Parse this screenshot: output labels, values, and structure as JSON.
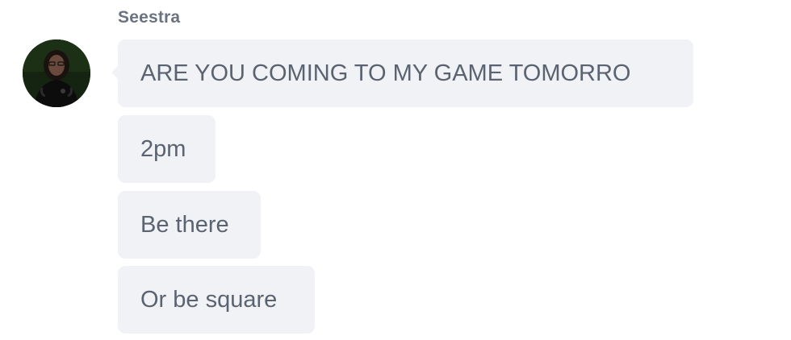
{
  "message_group": {
    "sender": "Seestra",
    "messages": [
      {
        "text": "ARE YOU COMING TO MY GAME TOMORRO"
      },
      {
        "text": "2pm"
      },
      {
        "text": "Be there"
      },
      {
        "text": "Or be square"
      }
    ]
  },
  "colors": {
    "bubble_background": "#f0f2f6",
    "message_text": "#5b6370",
    "sender_name": "#6b7280"
  }
}
